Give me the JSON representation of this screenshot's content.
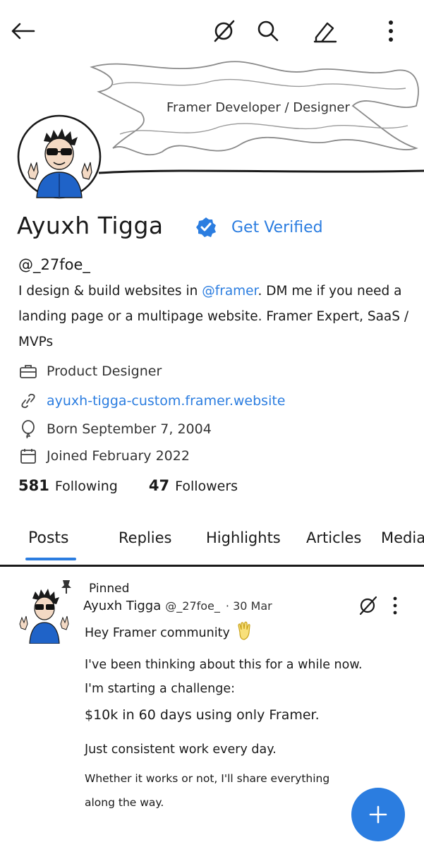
{
  "banner": {
    "text": "Framer Developer / Designer"
  },
  "profile": {
    "name": "Ayuxh Tigga",
    "get_verified": "Get Verified",
    "handle": "@_27foe_",
    "bio_pre": "I design & build websites in ",
    "bio_mention": "@framer",
    "bio_post": ". DM me if you need a landing page or a multipage website. Framer Expert, SaaS / MVPs",
    "job": "Product Designer",
    "website": "ayuxh-tigga-custom.framer.website",
    "born": "Born September 7, 2004",
    "joined": "Joined February 2022",
    "following_count": "581",
    "following_label": "Following",
    "followers_count": "47",
    "followers_label": "Followers"
  },
  "tabs": [
    "Posts",
    "Replies",
    "Highlights",
    "Articles",
    "Media"
  ],
  "post": {
    "pinned": "Pinned",
    "author": "Ayuxh Tigga",
    "handle": "@_27foe_",
    "date": "· 30 Mar",
    "line1": "Hey Framer community",
    "line2": "I've been thinking about this for a while now.",
    "line3": "I'm starting a challenge:",
    "line4": "$10k in 60 days using only Framer.",
    "line5": "Just consistent work every day.",
    "line6": "Whether it works or not, I'll share everything",
    "line7": "along the way."
  },
  "colors": {
    "accent": "#2b7de0",
    "ink": "#1a1a1a"
  },
  "icons": [
    "back-arrow-icon",
    "no-grok-icon",
    "search-icon",
    "edit-icon",
    "more-icon",
    "verified-badge-icon",
    "briefcase-icon",
    "link-icon",
    "balloon-icon",
    "calendar-icon",
    "pin-icon",
    "wave-hand-icon",
    "plus-icon"
  ]
}
